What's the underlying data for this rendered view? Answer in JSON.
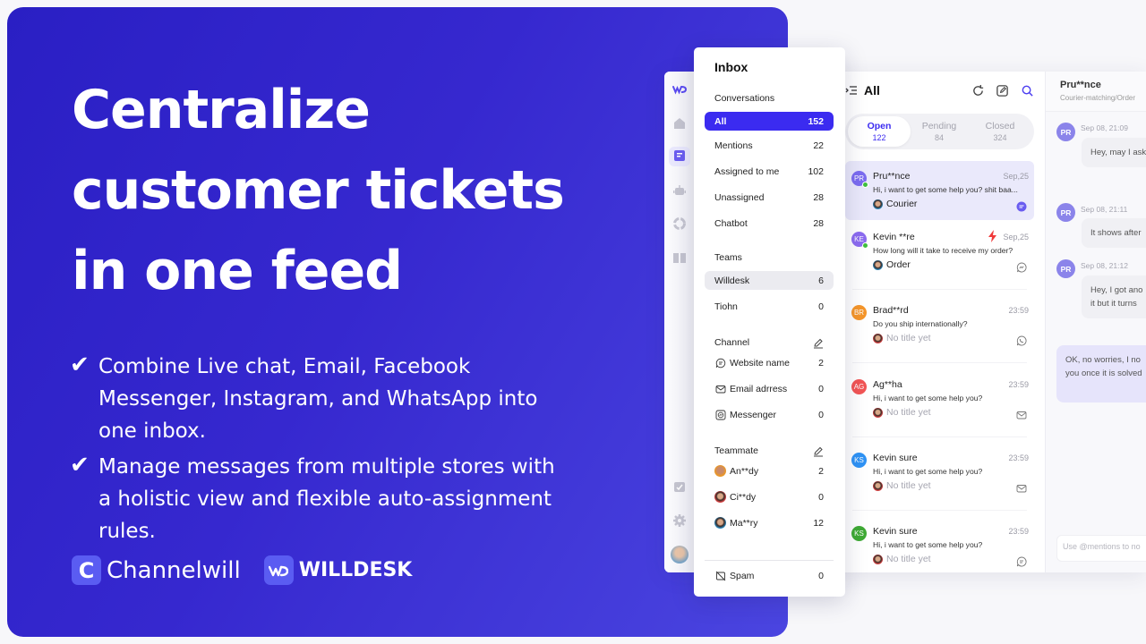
{
  "hero": {
    "title_lines": [
      "Centralize",
      "customer tickets",
      "in one feed"
    ],
    "bullets": [
      "Combine Live chat, Email, Facebook Messenger, Instagram, and WhatsApp into one inbox.",
      "Manage messages from multiple stores with a holistic view and flexible auto-assignment rules."
    ],
    "brands": [
      {
        "logo_text": "C",
        "name": "Channelwill"
      },
      {
        "logo_text": "WD",
        "name": "WILLDESK"
      }
    ]
  },
  "colors": {
    "brand": "#3b2bf0",
    "hero_start": "#2a1fc4",
    "hero_end": "#4a45e0",
    "online": "#3fbf3f",
    "urgent": "#f03a3a"
  },
  "rail": {
    "icons": [
      "willdesk-logo-icon",
      "home-icon",
      "inbox-icon",
      "chatbot-icon",
      "analytics-icon",
      "knowledge-book-icon",
      "tasks-icon",
      "settings-icon",
      "user-avatar"
    ]
  },
  "inbox": {
    "title": "Inbox",
    "conversations": {
      "heading": "Conversations",
      "items": [
        {
          "label": "All",
          "count": "152"
        },
        {
          "label": "Mentions",
          "count": "22"
        },
        {
          "label": "Assigned to me",
          "count": "102"
        },
        {
          "label": "Unassigned",
          "count": "28"
        },
        {
          "label": "Chatbot",
          "count": "28"
        }
      ]
    },
    "teams": {
      "heading": "Teams",
      "items": [
        {
          "label": "Willdesk",
          "count": "6"
        },
        {
          "label": "Tiohn",
          "count": "0"
        }
      ]
    },
    "channel": {
      "heading": "Channel",
      "items": [
        {
          "label": "Website name",
          "count": "2",
          "icon": "chat-bubble-icon"
        },
        {
          "label": "Email adrress",
          "count": "0",
          "icon": "email-icon"
        },
        {
          "label": "Messenger",
          "count": "0",
          "icon": "messenger-icon"
        }
      ]
    },
    "teammate": {
      "heading": "Teammate",
      "items": [
        {
          "label": "An**dy",
          "count": "2"
        },
        {
          "label": "Ci**dy",
          "count": "0"
        },
        {
          "label": "Ma**ry",
          "count": "12"
        }
      ]
    },
    "spam": {
      "label": "Spam",
      "count": "0"
    }
  },
  "list": {
    "title": "All",
    "tabs": [
      {
        "label": "Open",
        "count": "122"
      },
      {
        "label": "Pending",
        "count": "84"
      },
      {
        "label": "Closed",
        "count": "324"
      }
    ],
    "conversations": [
      {
        "initials": "PR",
        "name": "Pru**nce",
        "time": "Sep,25",
        "message": "Hi, i want to get some help you? shit baa...",
        "tag": "Courier",
        "channel": "live-chat-icon",
        "avatar_color": "#7b6cf0",
        "online": true,
        "urgent": false
      },
      {
        "initials": "KE",
        "name": "Kevin **re",
        "time": "Sep,25",
        "message": "How long will it take to receive my order?",
        "tag": "Order",
        "channel": "messenger-icon",
        "avatar_color": "#8c6cf0",
        "online": true,
        "urgent": true
      },
      {
        "initials": "BR",
        "name": "Brad**rd",
        "time": "23:59",
        "message": "Do you ship internationally?",
        "tag": "No title yet",
        "channel": "whatsapp-icon",
        "avatar_color": "#f5962a",
        "online": false,
        "urgent": false
      },
      {
        "initials": "AG",
        "name": "Ag**ha",
        "time": "23:59",
        "message": "Hi, i want to get some help you?",
        "tag": "No title yet",
        "channel": "email-icon",
        "avatar_color": "#f25555",
        "online": false,
        "urgent": false
      },
      {
        "initials": "KS",
        "name": "Kevin sure",
        "time": "23:59",
        "message": "Hi, i want to get some help you?",
        "tag": "No title yet",
        "channel": "email-icon",
        "avatar_color": "#2f93f5",
        "online": false,
        "urgent": false
      },
      {
        "initials": "KS",
        "name": "Kevin sure",
        "time": "23:59",
        "message": "Hi, i want to get some help you?",
        "tag": "No title yet",
        "channel": "chat-bubble-icon",
        "avatar_color": "#3faa35",
        "online": false,
        "urgent": false
      }
    ]
  },
  "chat": {
    "name": "Pru**nce",
    "subtitle": "Courier-matching/Order",
    "messages": [
      {
        "initials": "PR",
        "time": "Sep 08, 21:09",
        "text": [
          "Hey, may I ask"
        ]
      },
      {
        "initials": "PR",
        "time": "Sep 08, 21:11",
        "text": [
          "It shows after"
        ]
      },
      {
        "initials": "PR",
        "time": "Sep 08, 21:12",
        "text": [
          "Hey, I got ano",
          "it but it turns"
        ]
      }
    ],
    "reply": [
      "OK, no worries, I no",
      "you once it is solved"
    ],
    "composer_placeholder": "Use @mentions to no"
  }
}
